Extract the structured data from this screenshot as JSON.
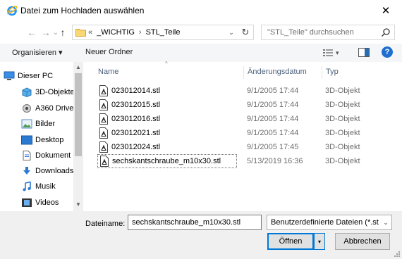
{
  "window": {
    "title": "Datei zum Hochladen auswählen",
    "close_glyph": "✕"
  },
  "nav": {
    "back_glyph": "←",
    "forward_glyph": "→",
    "recent_glyph": "⌄",
    "up_glyph": "↑"
  },
  "address": {
    "crumbs": [
      "«",
      "_WICHTIG",
      "›",
      "STL_Teile"
    ],
    "dropdown_glyph": "⌄",
    "refresh_glyph": "↻"
  },
  "search": {
    "placeholder": "\"STL_Teile\" durchsuchen"
  },
  "toolbar": {
    "organize": "Organisieren ▾",
    "new_folder": "Neuer Ordner",
    "view_glyph": "▾",
    "help": "?"
  },
  "sidebar": {
    "items": [
      {
        "label": "Dieser PC",
        "icon": "computer-icon"
      },
      {
        "label": "3D-Objekte",
        "icon": "cube-icon"
      },
      {
        "label": "A360 Drive",
        "icon": "drive-icon"
      },
      {
        "label": "Bilder",
        "icon": "pictures-icon"
      },
      {
        "label": "Desktop",
        "icon": "desktop-icon"
      },
      {
        "label": "Dokument",
        "icon": "document-icon"
      },
      {
        "label": "Downloads",
        "icon": "download-icon"
      },
      {
        "label": "Musik",
        "icon": "music-icon"
      },
      {
        "label": "Videos",
        "icon": "video-icon"
      }
    ],
    "scroll_up": "▲",
    "scroll_down": "▼"
  },
  "files": {
    "sort_indicator": "^",
    "columns": {
      "name": "Name",
      "date": "Änderungsdatum",
      "type": "Typ"
    },
    "rows": [
      {
        "name": "023012014.stl",
        "date": "9/1/2005 17:44",
        "type": "3D-Objekt",
        "selected": false
      },
      {
        "name": "023012015.stl",
        "date": "9/1/2005 17:44",
        "type": "3D-Objekt",
        "selected": false
      },
      {
        "name": "023012016.stl",
        "date": "9/1/2005 17:44",
        "type": "3D-Objekt",
        "selected": false
      },
      {
        "name": "023012021.stl",
        "date": "9/1/2005 17:44",
        "type": "3D-Objekt",
        "selected": false
      },
      {
        "name": "023012024.stl",
        "date": "9/1/2005 17:45",
        "type": "3D-Objekt",
        "selected": false
      },
      {
        "name": "sechskantschraube_m10x30.stl",
        "date": "5/13/2019 16:36",
        "type": "3D-Objekt",
        "selected": true
      }
    ]
  },
  "footer": {
    "filename_label": "Dateiname:",
    "filename_value": "sechskantschraube_m10x30.stl",
    "filter_value": "Benutzerdefinierte Dateien (*.st",
    "filter_glyph": "⌄",
    "open_label": "Öffnen",
    "open_split_glyph": "▾",
    "cancel_label": "Abbrechen"
  }
}
